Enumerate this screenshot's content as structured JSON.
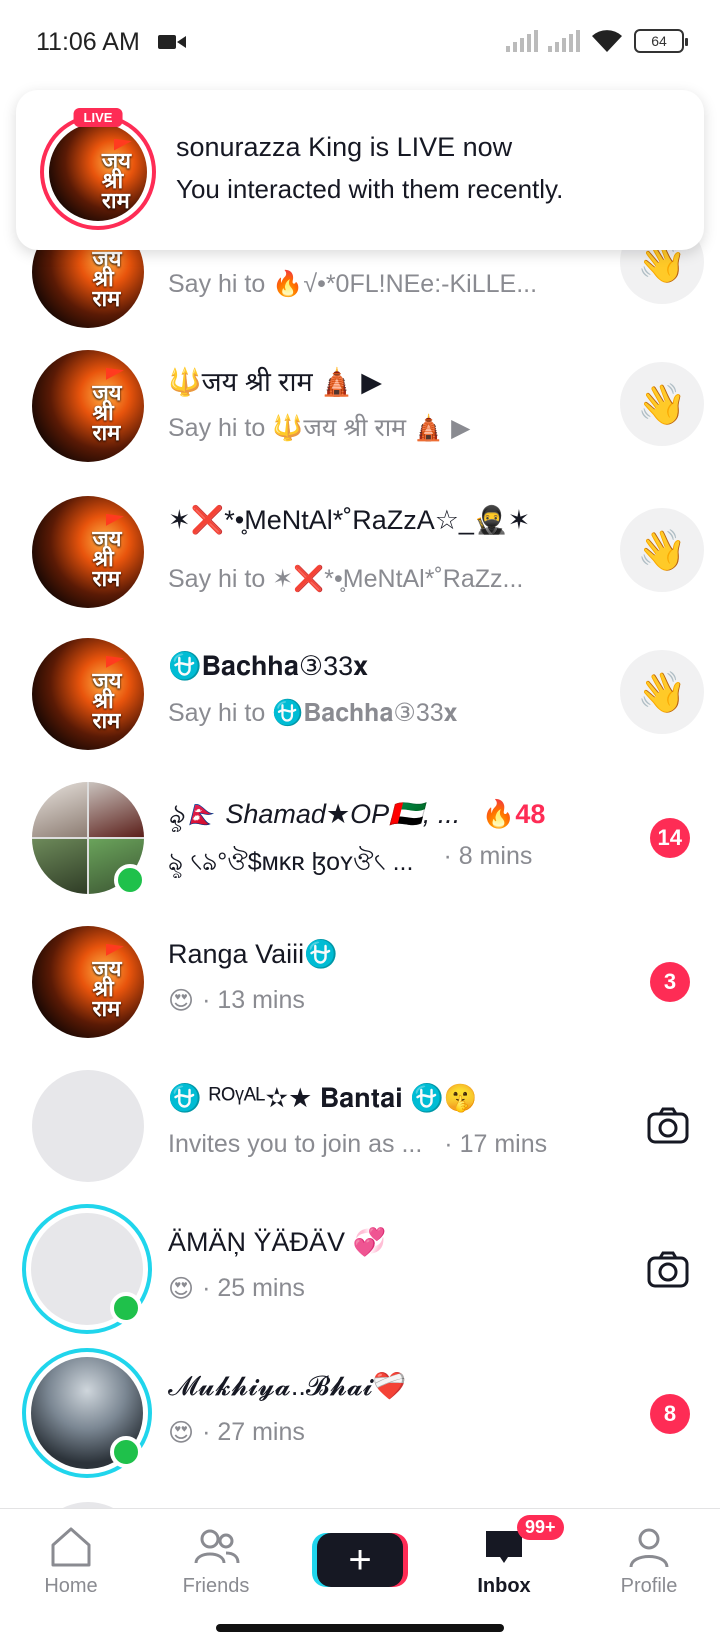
{
  "status_bar": {
    "time": "11:06 AM",
    "battery": "64"
  },
  "notification": {
    "live_label": "LIVE",
    "title": "sonurazza King is LIVE now",
    "subtitle": "You interacted with them recently."
  },
  "avatar_text": "जय श्री राम",
  "conversations": [
    {
      "name": "",
      "preview": "Say hi to 🔥√•*0FL!NEe:-KiLLE...",
      "action": "wave"
    },
    {
      "name": "🔱जय श्री राम 🛕 ▶",
      "preview": "Say hi to 🔱जय श्री राम 🛕 ▶",
      "action": "wave"
    },
    {
      "name": "✶❌*•̥MeNtAl*˚RaZzA☆_🥷✶",
      "preview": "Say hi to ✶❌*•̥MeNtAl*˚RaZz...",
      "action": "wave"
    },
    {
      "name": "⛎𝐁𝐚𝐜𝐡𝐡𝐚③33𝐱",
      "preview": "Say hi to ⛎𝐁𝐚𝐜𝐡𝐡𝐚③33𝐱",
      "action": "wave"
    },
    {
      "name": "ৡ🇳🇵 Shamad★OP🇦🇪, ...",
      "streak": "🔥48",
      "preview": "ৡ ৻ঌ°ঔ$ᴍᴋʀ ɮᴏʏঔ৻ ...",
      "time": "· 8 mins",
      "badge": "14"
    },
    {
      "name": "Ranga Vaiii⛎",
      "preview": "😍",
      "time": "· 13 mins",
      "badge": "3"
    },
    {
      "name": "⛎ ᴿᴼᵞᴬᴸ✫★ 𝐁𝐚𝐧𝐭𝐚𝐢 ⛎🤫",
      "preview": "Invites you to join as ...",
      "time": "· 17 mins",
      "action": "camera"
    },
    {
      "name": "ÄMÄŅ ŸÄĐÄV 💞",
      "preview": "😍",
      "time": "· 25 mins",
      "action": "camera"
    },
    {
      "name": "𝓜𝓾𝓴𝓱𝓲𝔂𝓪..𝓑𝓱𝓪𝓲❤️‍🩹",
      "preview": "😍",
      "time": "· 27 mins",
      "badge": "8"
    }
  ],
  "nav": {
    "home": "Home",
    "friends": "Friends",
    "create": "+",
    "inbox": "Inbox",
    "inbox_badge": "99+",
    "profile": "Profile"
  },
  "colors": {
    "accent_red": "#fe2c55",
    "accent_cyan": "#20d5ec",
    "online_green": "#1fc14b"
  }
}
